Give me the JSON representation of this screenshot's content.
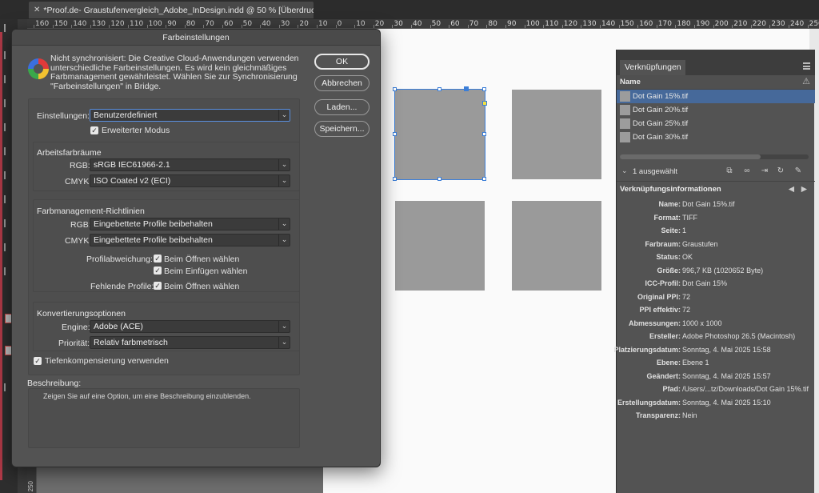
{
  "document": {
    "tab_title": "*Proof.de- Graustufenvergleich_Adobe_InDesign.indd @ 50 % [Überdruckenvorschau]",
    "ruler_top": [
      "160",
      "150",
      "140",
      "130",
      "120",
      "110",
      "100",
      "90",
      "80",
      "70",
      "60",
      "50",
      "40",
      "30",
      "20",
      "10",
      "0",
      "10",
      "20",
      "30",
      "40",
      "50",
      "60",
      "70",
      "80",
      "90",
      "100",
      "110",
      "120",
      "130",
      "140",
      "150",
      "160",
      "170",
      "180",
      "190",
      "200",
      "210",
      "220",
      "230",
      "240",
      "250"
    ],
    "ruler_left": "250"
  },
  "dialog": {
    "title": "Farbeinstellungen",
    "sync_message": "Nicht synchronisiert: Die Creative Cloud-Anwendungen verwenden unterschiedliche Farbeinstellungen. Es wird kein gleichmäßiges Farbmanagement gewährleistet. Wählen Sie zur Synchronisierung \"Farbeinstellungen\" in Bridge.",
    "buttons": {
      "ok": "OK",
      "cancel": "Abbrechen",
      "load": "Laden...",
      "save": "Speichern..."
    },
    "settings_label": "Einstellungen:",
    "settings_value": "Benutzerdefiniert",
    "advanced_mode": "Erweiterter Modus",
    "working_spaces": {
      "title": "Arbeitsfarbräume",
      "rgb_label": "RGB:",
      "rgb_value": "sRGB IEC61966-2.1",
      "cmyk_label": "CMYK:",
      "cmyk_value": "ISO Coated v2 (ECI)"
    },
    "policies": {
      "title": "Farbmanagement-Richtlinien",
      "rgb_label": "RGB:",
      "rgb_value": "Eingebettete Profile beibehalten",
      "cmyk_label": "CMYK:",
      "cmyk_value": "Eingebettete Profile beibehalten",
      "mismatch_label": "Profilabweichung:",
      "mismatch_open": "Beim Öffnen wählen",
      "mismatch_paste": "Beim Einfügen wählen",
      "missing_label": "Fehlende Profile:",
      "missing_open": "Beim Öffnen wählen"
    },
    "conversion": {
      "title": "Konvertierungsoptionen",
      "engine_label": "Engine:",
      "engine_value": "Adobe (ACE)",
      "intent_label": "Priorität:",
      "intent_value": "Relativ farbmetrisch",
      "bpc": "Tiefenkompensierung verwenden"
    },
    "description": {
      "title": "Beschreibung:",
      "text": "Zeigen Sie auf eine Option, um eine Beschreibung einzublenden."
    }
  },
  "links": {
    "tab": "Verknüpfungen",
    "column_name": "Name",
    "items": [
      "Dot Gain 15%.tif",
      "Dot Gain 20%.tif",
      "Dot Gain 25%.tif",
      "Dot Gain 30%.tif"
    ],
    "selected_count": "1 ausgewählt",
    "info_title": "Verknüpfungsinformationen",
    "info": [
      {
        "k": "Name:",
        "v": "Dot Gain 15%.tif"
      },
      {
        "k": "Format:",
        "v": "TIFF"
      },
      {
        "k": "Seite:",
        "v": "1"
      },
      {
        "k": "Farbraum:",
        "v": "Graustufen"
      },
      {
        "k": "Status:",
        "v": "OK"
      },
      {
        "k": "Größe:",
        "v": "996,7 KB (1020652 Byte)"
      },
      {
        "k": "ICC-Profil:",
        "v": "Dot Gain 15%"
      },
      {
        "k": "Original PPI:",
        "v": "72"
      },
      {
        "k": "PPI effektiv:",
        "v": "72"
      },
      {
        "k": "Abmessungen:",
        "v": "1000 x 1000"
      },
      {
        "k": "Ersteller:",
        "v": "Adobe Photoshop 26.5 (Macintosh)"
      },
      {
        "k": "Platzierungsdatum:",
        "v": "Sonntag, 4. Mai 2025 15:58"
      },
      {
        "k": "Ebene:",
        "v": "Ebene 1"
      },
      {
        "k": "Geändert:",
        "v": "Sonntag, 4. Mai 2025 15:57"
      },
      {
        "k": "Pfad:",
        "v": "/Users/...tz/Downloads/Dot Gain 15%.tif"
      },
      {
        "k": "Erstellungsdatum:",
        "v": "Sonntag, 4. Mai 2025 15:10"
      },
      {
        "k": "Transparenz:",
        "v": "Nein"
      }
    ]
  }
}
